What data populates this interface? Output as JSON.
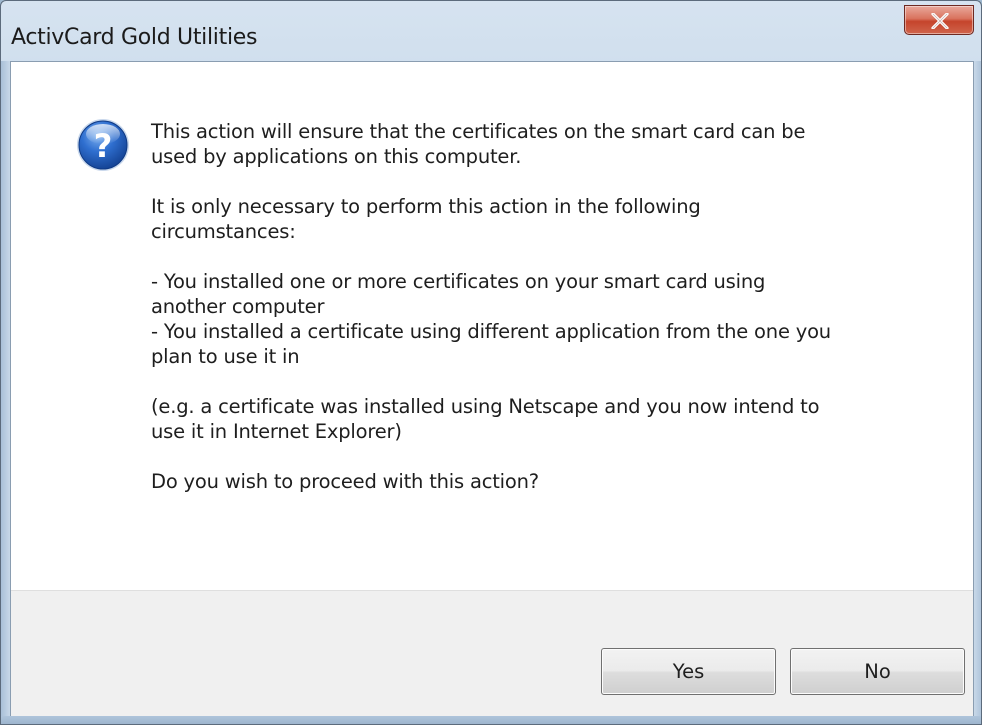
{
  "window": {
    "title": "ActivCard Gold Utilities",
    "close_icon": "close-x-icon"
  },
  "dialog": {
    "icon": "question-icon",
    "paragraphs": [
      "This action will ensure that the certificates on the smart card can be\nused by applications on this computer.",
      "It is only necessary to perform this action in the following\ncircumstances:",
      "- You installed one or more certificates on your smart card using\nanother computer\n- You installed a certificate using different application from the one you\nplan to use it in",
      "(e.g. a certificate was installed using Netscape and you now intend to\nuse it in Internet Explorer)",
      "Do you wish to proceed with this action?"
    ]
  },
  "buttons": {
    "yes_label": "Yes",
    "no_label": "No"
  },
  "colors": {
    "title_bar": "#c2d5e8",
    "close_button": "#c5442c",
    "question_icon": "#1f5fb8",
    "button_bar": "#f0f0f0"
  }
}
